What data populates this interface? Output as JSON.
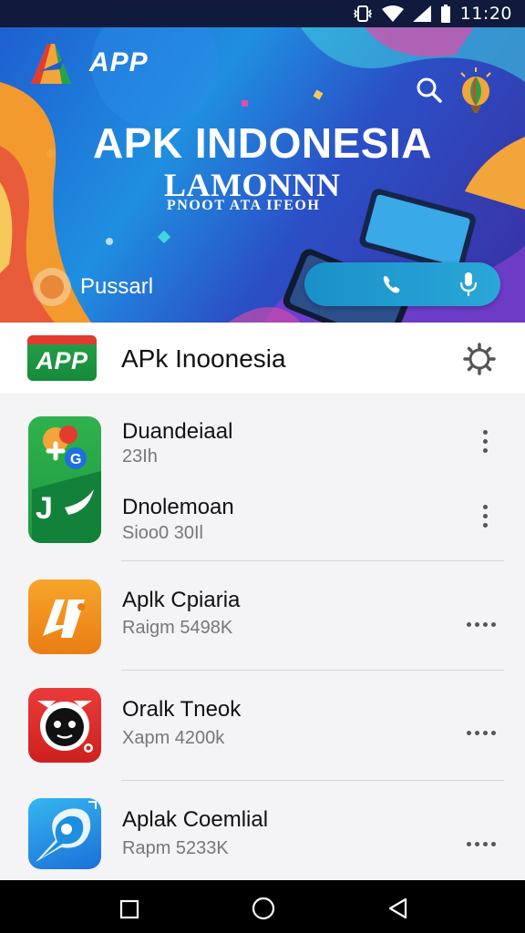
{
  "status_bar": {
    "time": "11:20",
    "icons": [
      "vibrate-icon",
      "wifi-icon",
      "signal-icon",
      "battery-icon"
    ]
  },
  "banner": {
    "brand": "APP",
    "title": "APK INDONESIA",
    "subtitle": "LAMONNN",
    "tagline": "PNOOT ATA IFEOH",
    "user_name": "Pussarl",
    "icons": [
      "app-logo-icon",
      "search-icon",
      "balloon-icon",
      "phone-icon",
      "microphone-icon"
    ]
  },
  "header": {
    "logo_text": "APP",
    "title": "APk Inoonesia",
    "settings_icon": "settings-icon"
  },
  "list": {
    "items": [
      {
        "title": "Duandeiaal",
        "subtitle": "23Ih",
        "menu_icon": "more-vertical-icon"
      },
      {
        "title": "Dnolemoan",
        "subtitle": "Sioo0 30Il",
        "menu_icon": "more-vertical-icon"
      },
      {
        "title": "Aplk Cpiaria",
        "subtitle": "Raigm 5498K",
        "menu_icon": "more-horizontal-icon"
      },
      {
        "title": "Oralk Tneok",
        "subtitle": "Xapm 4200k",
        "menu_icon": "more-horizontal-icon"
      },
      {
        "title": "Aplak Coemlial",
        "subtitle": "Rapm 5233K",
        "menu_icon": "more-horizontal-icon"
      }
    ]
  },
  "nav_bar": {
    "icons": [
      "recent-apps-icon",
      "home-icon",
      "back-icon"
    ]
  },
  "colors": {
    "status_bar": "#0f1a3c",
    "banner_blue": "#1f8fe0",
    "app_green": "#25a24a",
    "app_red": "#e23b2f",
    "orange": "#f08a1c",
    "nav_bar": "#000000"
  }
}
